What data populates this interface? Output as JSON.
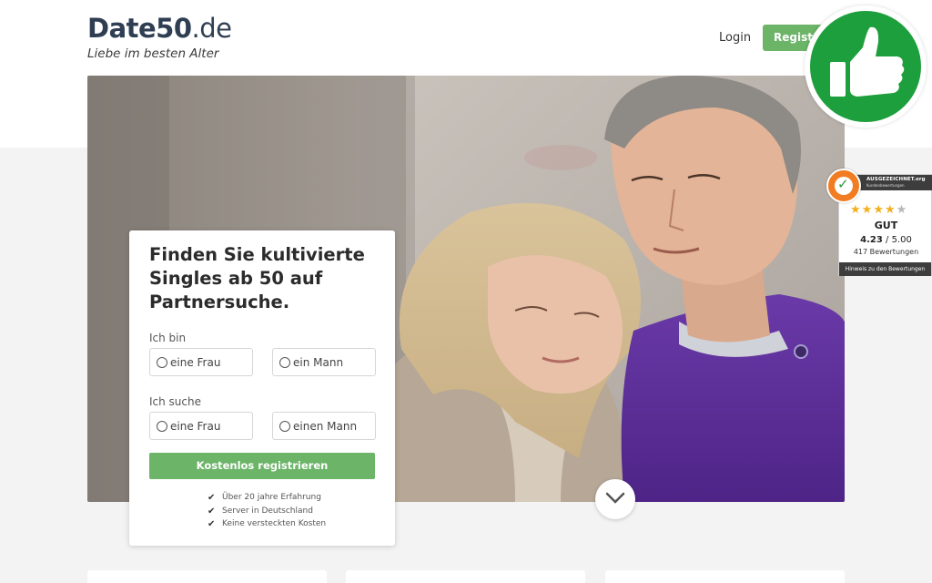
{
  "header": {
    "logo_main": "Date50",
    "logo_suffix": ".de",
    "tagline": "Liebe im besten Alter",
    "login_label": "Login",
    "register_label": "Registr"
  },
  "hero": {
    "image_icon": "couple-photo"
  },
  "form": {
    "title": "Finden Sie kultivierte Singles ab 50 auf Partnersuche.",
    "i_am_label": "Ich bin",
    "i_am_options": [
      "eine Frau",
      "ein Mann"
    ],
    "seeking_label": "Ich suche",
    "seeking_options": [
      "eine Frau",
      "einen Mann"
    ],
    "submit_label": "Kostenlos registrieren",
    "benefits": [
      "Über 20 jahre Erfahrung",
      "Server in Deutschland",
      "Keine versteckten Kosten"
    ]
  },
  "rating": {
    "header_title": "AUSGEZEICHNET.org",
    "header_subtitle": "Kundenbewertungen",
    "stars_filled": 4,
    "stars_total": 5,
    "grade": "GUT",
    "score": "4.23",
    "score_max": "/ 5.00",
    "count": "417 Bewertungen",
    "footer": "Hinweis zu den Bewertungen"
  },
  "icons": {
    "thumbs_up": "thumbs-up-icon",
    "scroll_down": "chevron-down-icon",
    "check": "check-icon",
    "seal": "award-seal-icon"
  },
  "colors": {
    "brand_dark": "#2f3e52",
    "accent_green": "#6bb468",
    "thumb_green": "#1e9f3d",
    "star_gold": "#f2b01e",
    "seal_orange": "#f27c22"
  }
}
